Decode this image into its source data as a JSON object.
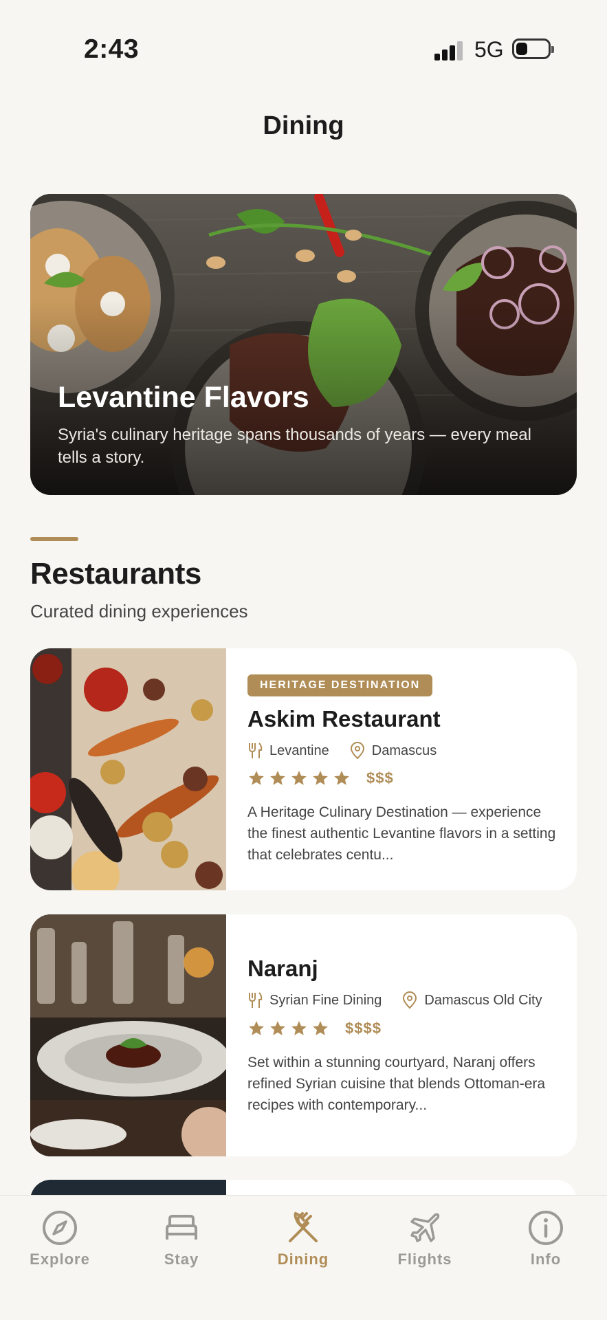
{
  "status_bar": {
    "time": "2:43",
    "network": "5G"
  },
  "header": {
    "title": "Dining"
  },
  "hero": {
    "title": "Levantine Flavors",
    "subtitle": "Syria's culinary heritage spans thousands of years — every meal tells a story."
  },
  "section": {
    "title": "Restaurants",
    "subtitle": "Curated dining experiences"
  },
  "restaurants": [
    {
      "badge": "HERITAGE DESTINATION",
      "name": "Askim Restaurant",
      "cuisine": "Levantine",
      "location": "Damascus",
      "rating": 5,
      "price": "$$$",
      "description": "A Heritage Culinary Destination — experience the finest authentic Levantine flavors in a setting that celebrates centu..."
    },
    {
      "name": "Naranj",
      "cuisine": "Syrian Fine Dining",
      "location": "Damascus Old City",
      "rating": 4,
      "price": "$$$$",
      "description": "Set within a stunning courtyard, Naranj offers refined Syrian cuisine that blends Ottoman-era recipes with contemporary..."
    }
  ],
  "tabs": [
    {
      "label": "Explore",
      "icon": "compass-icon"
    },
    {
      "label": "Stay",
      "icon": "bed-icon"
    },
    {
      "label": "Dining",
      "icon": "fork-knife-icon",
      "active": true
    },
    {
      "label": "Flights",
      "icon": "plane-icon"
    },
    {
      "label": "Info",
      "icon": "info-icon"
    }
  ],
  "colors": {
    "accent": "#b08d57",
    "background": "#f7f6f2",
    "inactive_tab": "#9b9a97"
  }
}
